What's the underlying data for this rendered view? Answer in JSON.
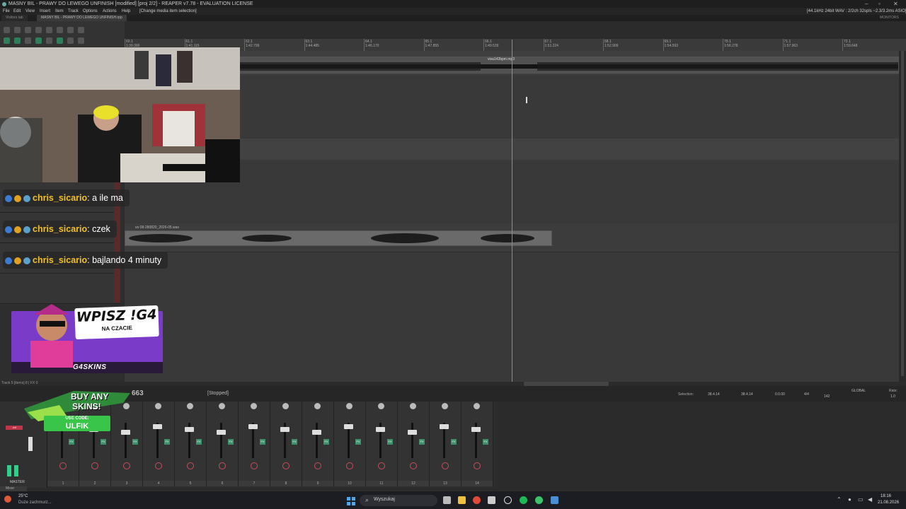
{
  "window": {
    "title": "MASNY BIL - PRAWY DO LEWEGO UNFINISH [modified] [proj 2/2] - REAPER v7.78 - EVALUATION LICENSE",
    "status_right": "[44.1kHz 24bit WAV : 2/2ch 32spls ~2.3/3.2ms ASIO]",
    "monitor_label": "MONITORS"
  },
  "menu": {
    "items": [
      "File",
      "Edit",
      "View",
      "Insert",
      "Item",
      "Track",
      "Options",
      "Actions",
      "Help"
    ],
    "hint": "[Change media item selection]"
  },
  "tabs": [
    "Visitors tab",
    "MASNY BIL - PRAWY DO LEWEGO UNFINISH.rpp"
  ],
  "ruler": {
    "labels": [
      "60.1",
      "61.1",
      "62.1",
      "63.1",
      "64.1",
      "65.1",
      "66.1",
      "67.1",
      "68.1",
      "69.1",
      "70.1",
      "71.1",
      "72.1"
    ],
    "sublabels": [
      "1:39.390",
      "1:41.115",
      "1:42.799",
      "1:44.485",
      "1:46.170",
      "1:47.855",
      "1:49.539",
      "1:51.224",
      "1:52.909",
      "1:54.593",
      "1:56.278",
      "1:57.963",
      "1:59.648"
    ]
  },
  "items": {
    "top_item_name": "vixa142bpm.mp3",
    "mid_item_name": "vo 08-280820_2026-05.wav"
  },
  "chat": [
    {
      "user": "chris_sicario",
      "message": "a ile ma"
    },
    {
      "user": "chris_sicario",
      "message": "czek"
    },
    {
      "user": "chris_sicario",
      "message": "bajlando 4 minuty"
    }
  ],
  "promo": {
    "headline": "WPISZ !G4",
    "sub": "NA CZACIE",
    "brand": "G4SKINS"
  },
  "buy": {
    "line1": "BUY ANY",
    "line2": "SKINS!",
    "code_label": "USE CODE:",
    "code": "ULFIK"
  },
  "transport": {
    "position_partial": "663",
    "state": "[Stopped]",
    "track_info": "Track 5 [items] 8 | FX 0",
    "selection_label": "Selection:",
    "selection_start": "38.4.14",
    "selection_end": "38.4.14",
    "selection_len": "0.0.00",
    "time_sig": "4/4",
    "bpm": "142",
    "rate_label": "Rate:",
    "rate": "1.0",
    "global_label": "GLOBAL"
  },
  "mixer": {
    "master_label": "MASTER",
    "mixer_label": "Mixer",
    "strip_name": "vixa142bpm",
    "channel_numbers": [
      "1",
      "2",
      "3",
      "4",
      "5",
      "6",
      "7",
      "8",
      "9",
      "10",
      "11",
      "12",
      "13",
      "14"
    ],
    "volume_readout": "-inf"
  },
  "taskbar": {
    "weather_temp": "25°C",
    "weather_desc": "Duże zachmurz...",
    "search_placeholder": "Wyszukaj",
    "time": "18:16",
    "date": "21.08.2026"
  },
  "colors": {
    "accent_green": "#3f8f6a",
    "cursor": "#5aa88f",
    "chat_user": "#f0c02a",
    "promo_purple": "#8a3fd1"
  }
}
